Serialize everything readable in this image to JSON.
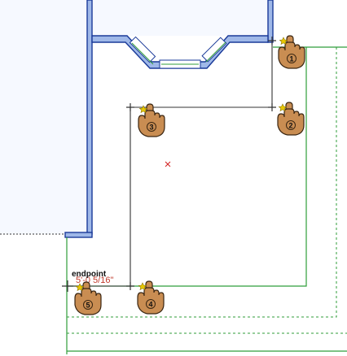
{
  "app": {
    "view": "floor-plan-drawing-canvas"
  },
  "snap": {
    "label": "endpoint"
  },
  "dimension": {
    "text": "5'-0 5/16\""
  },
  "markers": [
    {
      "number": "1"
    },
    {
      "number": "2"
    },
    {
      "number": "3"
    },
    {
      "number": "4"
    },
    {
      "number": "5"
    }
  ],
  "colors": {
    "wall_fill": "#9fb8e8",
    "wall_outline": "#1a3a99",
    "room_fill": "#f6f9ff",
    "sketch_line": "#333333",
    "green_line": "#2f9e3a",
    "hand_fill": "#c98d52",
    "hand_outline": "#3a2612",
    "snap_star": "#e8c800",
    "center_mark": "#d22020"
  },
  "icons": [
    "hand-pointer-icon",
    "crosshair-icon",
    "snap-star-icon",
    "center-point-icon"
  ]
}
